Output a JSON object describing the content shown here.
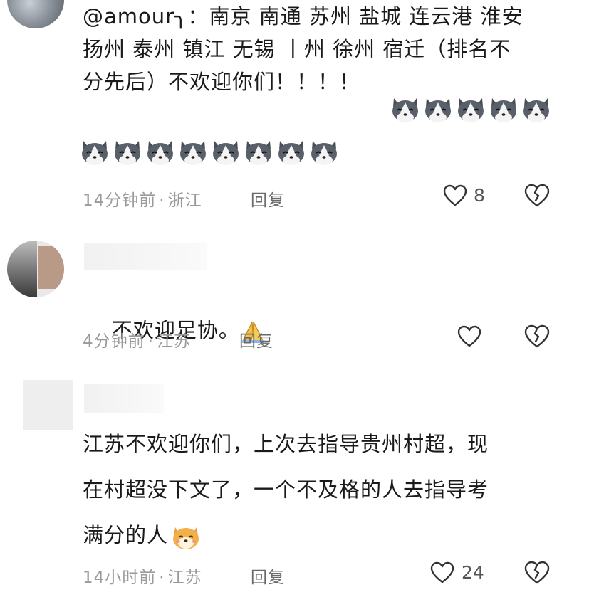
{
  "comments": [
    {
      "text": "@amour╮：南京 南通 苏州 盐城 连云港 淮安\n扬州 泰州 镇江 无锡 丨州 徐州 宿迁（排名不\n分先后）不欢迎你们！！！！",
      "emoji_icon": "husky-emoji",
      "emoji_count": 13,
      "time": "14分钟前",
      "location": "浙江",
      "reply_label": "回复",
      "likes": "8"
    },
    {
      "text": "不欢迎足协。",
      "emoji_icon": "folded-hands-emoji",
      "time": "4分钟前",
      "location": "江苏",
      "reply_label": "回复",
      "likes": ""
    },
    {
      "text": "江苏不欢迎你们，上次去指导贵州村超，现\n在村超没下文了，一个不及格的人去指导考\n满分的人",
      "emoji_icon": "shiba-emoji",
      "time": "14小时前",
      "location": "江苏",
      "reply_label": "回复",
      "likes": "24"
    }
  ],
  "separator": "·",
  "icons": {
    "like": "heart-outline-icon",
    "dislike": "broken-heart-icon"
  },
  "colors": {
    "text": "#1a1a1a",
    "meta": "#9a9a9a",
    "icon": "#333333"
  }
}
